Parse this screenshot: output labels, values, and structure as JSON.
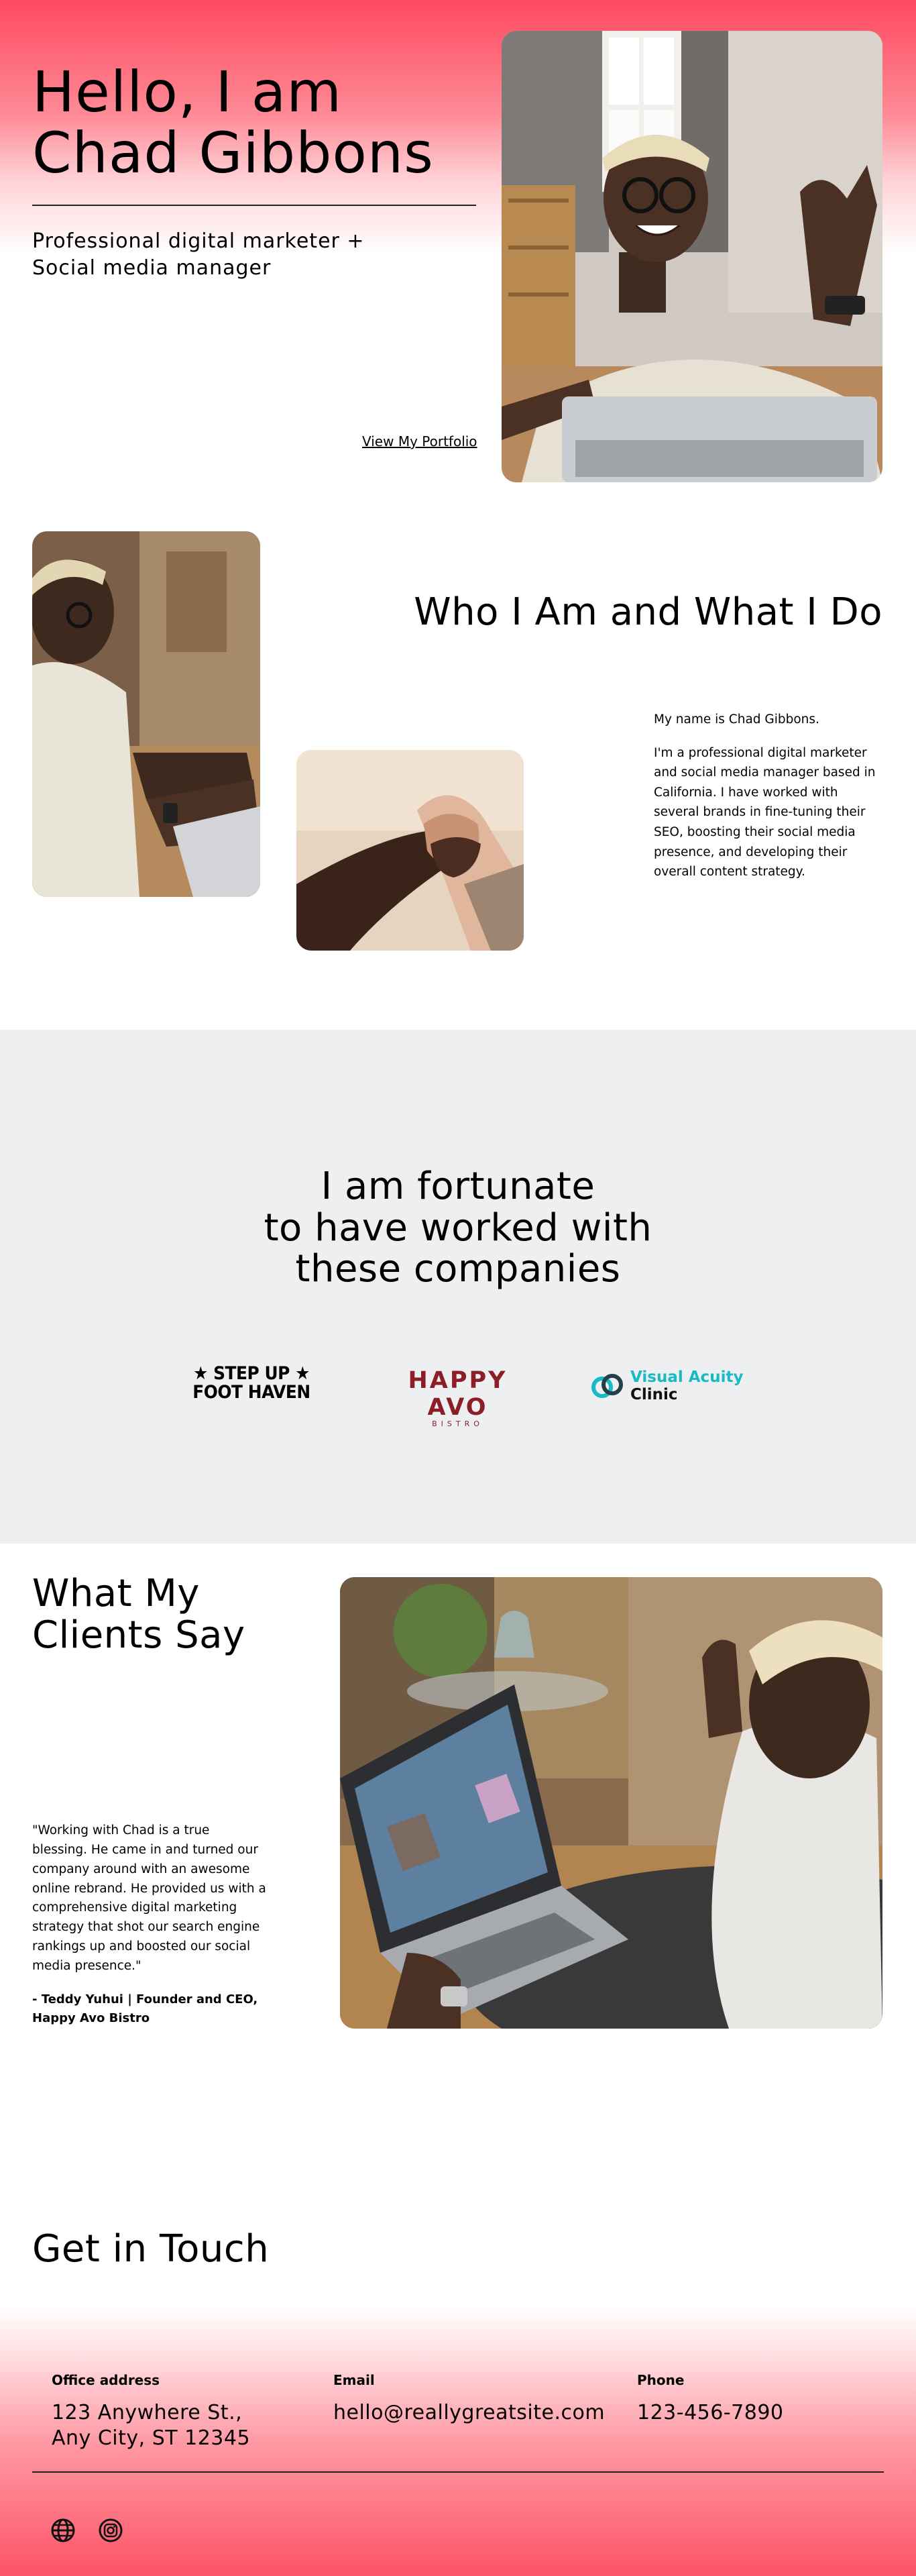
{
  "hero": {
    "title_line1": "Hello, I am",
    "title_line2": "Chad Gibbons",
    "subtitle_line1": "Professional digital marketer +",
    "subtitle_line2": "Social media manager",
    "portfolio_link": "View My Portfolio"
  },
  "about": {
    "title": "Who I Am and What I Do",
    "paragraph1": "My name is Chad Gibbons.",
    "paragraph2": "I'm a professional digital marketer and social media manager based in California. I have worked with several brands in fine-tuning their SEO, boosting their social media presence, and developing their overall content strategy."
  },
  "companies": {
    "title_line1": "I am fortunate",
    "title_line2": "to have worked with",
    "title_line3": "these companies",
    "logos": [
      {
        "line1": "★ STEP UP ★",
        "line2": "FOOT HAVEN"
      },
      {
        "line1": "HAPPY AVO",
        "line2": "BISTRO"
      },
      {
        "line1": "Visual Acuity",
        "line2": "Clinic"
      }
    ]
  },
  "testimonial": {
    "title_line1": "What My",
    "title_line2": "Clients Say",
    "quote": "\"Working with Chad is a true blessing. He came in and turned our company around with an awesome online rebrand. He provided us with a comprehensive digital marketing strategy that shot our search engine rankings up and boosted our social media presence.\"",
    "author": "- Teddy Yuhui | Founder and CEO, Happy Avo Bistro"
  },
  "contact": {
    "title": "Get in Touch",
    "office_label": "Office address",
    "office_line1": "123 Anywhere St.,",
    "office_line2": "Any City, ST 12345",
    "email_label": "Email",
    "email_value": "hello@reallygreatsite.com",
    "phone_label": "Phone",
    "phone_value": "123-456-7890"
  },
  "icons": {
    "globe": "globe-icon",
    "instagram": "instagram-icon"
  },
  "colors": {
    "accent_pink": "#fd4a5f",
    "section_gray": "#eeeff1",
    "avo_red": "#8b1e26",
    "acuity_teal": "#19b9c6"
  }
}
